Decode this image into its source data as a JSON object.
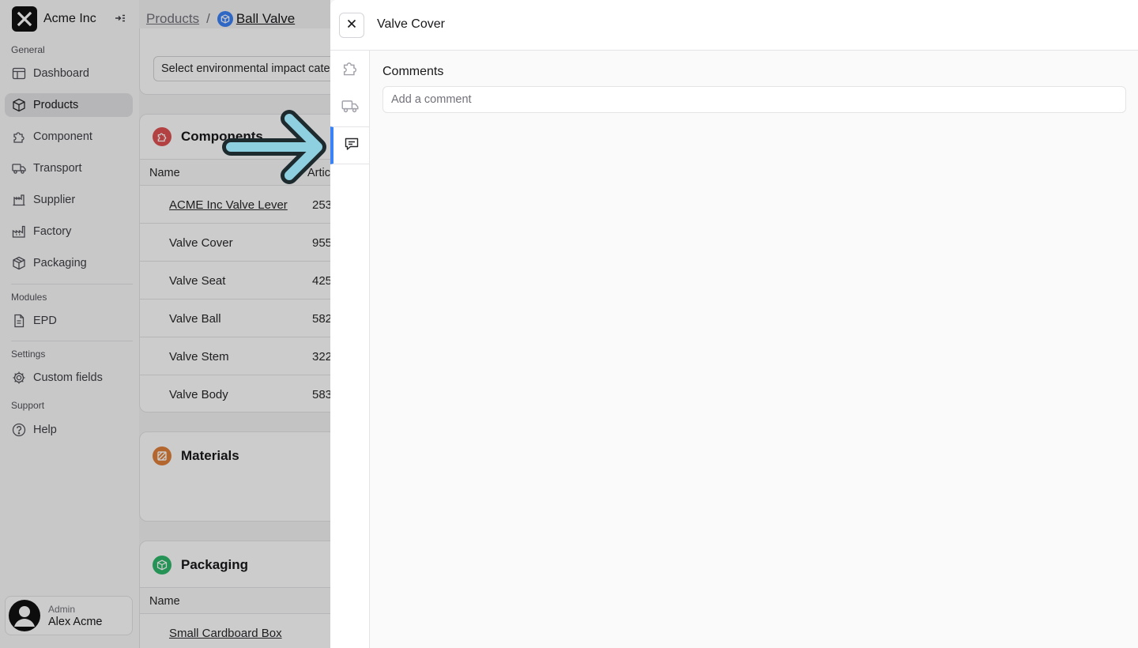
{
  "sidebar": {
    "brand": "Acme Inc",
    "sections": {
      "general": "General",
      "modules": "Modules",
      "settings": "Settings",
      "support": "Support"
    },
    "items": [
      {
        "label": "Dashboard",
        "icon": "dashboard-icon"
      },
      {
        "label": "Products",
        "icon": "cube-icon",
        "active": true
      },
      {
        "label": "Component",
        "icon": "puzzle-icon"
      },
      {
        "label": "Transport",
        "icon": "truck-icon"
      },
      {
        "label": "Supplier",
        "icon": "supplier-icon"
      },
      {
        "label": "Factory",
        "icon": "factory-icon"
      },
      {
        "label": "Packaging",
        "icon": "package-icon"
      },
      {
        "label": "EPD",
        "icon": "document-icon"
      },
      {
        "label": "Custom fields",
        "icon": "gear-icon"
      },
      {
        "label": "Help",
        "icon": "help-icon"
      }
    ],
    "user": {
      "role": "Admin",
      "name": "Alex Acme"
    }
  },
  "breadcrumb": {
    "root": "Products",
    "separator": "/",
    "current": "Ball Valve"
  },
  "main": {
    "impact_select": "Select environmental impact cate",
    "components": {
      "title": "Components",
      "columns": [
        "Name",
        "Artic"
      ],
      "rows": [
        {
          "name": "ACME Inc Valve Lever",
          "article": "253",
          "link": true
        },
        {
          "name": "Valve Cover",
          "article": "955"
        },
        {
          "name": "Valve Seat",
          "article": "425"
        },
        {
          "name": "Valve Ball",
          "article": "582"
        },
        {
          "name": "Valve Stem",
          "article": "322"
        },
        {
          "name": "Valve Body",
          "article": "583"
        }
      ]
    },
    "materials": {
      "title": "Materials"
    },
    "packaging": {
      "title": "Packaging",
      "columns": [
        "Name"
      ],
      "rows": [
        {
          "name": "Small Cardboard Box"
        }
      ]
    }
  },
  "drawer": {
    "title": "Valve Cover",
    "comments_label": "Comments",
    "comment_placeholder": "Add a comment",
    "rail": [
      "puzzle-icon",
      "truck-icon",
      "comment-icon"
    ]
  },
  "colors": {
    "accent": "#3b82f6",
    "components_badge": "#e05252",
    "materials_badge": "#e0803a",
    "packaging_badge": "#2fb86b",
    "arrow": "#8ecfe0"
  }
}
